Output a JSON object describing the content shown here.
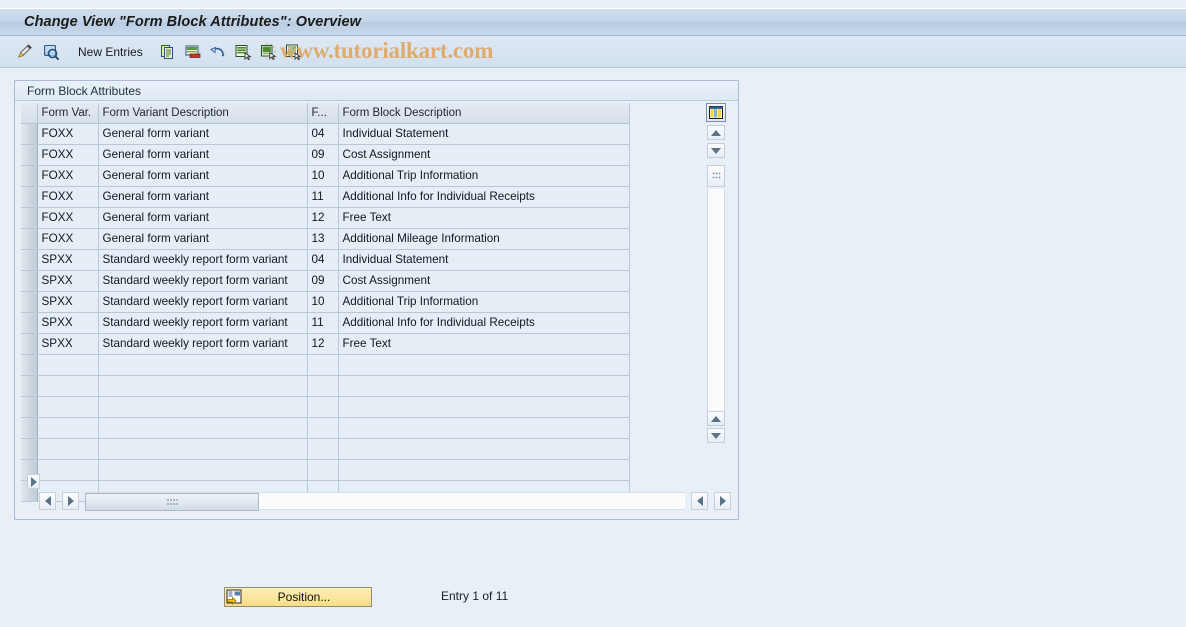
{
  "window": {
    "title": "Change View \"Form Block Attributes\": Overview"
  },
  "watermark": "www.tutorialkart.com",
  "toolbar": {
    "new_entries_label": "New Entries",
    "icons": [
      "display-change-icon",
      "display-detail-icon",
      "copy-icon",
      "delete-icon",
      "undo-icon",
      "select-all-icon",
      "select-block-icon",
      "deselect-icon"
    ]
  },
  "panel": {
    "title": "Form Block Attributes"
  },
  "table": {
    "columns": [
      "Form Var.",
      "Form Variant Description",
      "F...",
      "Form Block Description"
    ],
    "rows": [
      {
        "var": "FOXX",
        "vardesc": "General form variant",
        "f": "04",
        "blockdesc": "Individual Statement"
      },
      {
        "var": "FOXX",
        "vardesc": "General form variant",
        "f": "09",
        "blockdesc": "Cost Assignment"
      },
      {
        "var": "FOXX",
        "vardesc": "General form variant",
        "f": "10",
        "blockdesc": "Additional Trip Information"
      },
      {
        "var": "FOXX",
        "vardesc": "General form variant",
        "f": "11",
        "blockdesc": "Additional Info for Individual Receipts"
      },
      {
        "var": "FOXX",
        "vardesc": "General form variant",
        "f": "12",
        "blockdesc": "Free Text"
      },
      {
        "var": "FOXX",
        "vardesc": "General form variant",
        "f": "13",
        "blockdesc": "Additional Mileage Information"
      },
      {
        "var": "SPXX",
        "vardesc": "Standard weekly report form variant",
        "f": "04",
        "blockdesc": "Individual Statement"
      },
      {
        "var": "SPXX",
        "vardesc": "Standard weekly report form variant",
        "f": "09",
        "blockdesc": "Cost Assignment"
      },
      {
        "var": "SPXX",
        "vardesc": "Standard weekly report form variant",
        "f": "10",
        "blockdesc": "Additional Trip Information"
      },
      {
        "var": "SPXX",
        "vardesc": "Standard weekly report form variant",
        "f": "11",
        "blockdesc": "Additional Info for Individual Receipts"
      },
      {
        "var": "SPXX",
        "vardesc": "Standard weekly report form variant",
        "f": "12",
        "blockdesc": "Free Text"
      },
      {
        "var": "",
        "vardesc": "",
        "f": "",
        "blockdesc": ""
      },
      {
        "var": "",
        "vardesc": "",
        "f": "",
        "blockdesc": ""
      },
      {
        "var": "",
        "vardesc": "",
        "f": "",
        "blockdesc": ""
      },
      {
        "var": "",
        "vardesc": "",
        "f": "",
        "blockdesc": ""
      },
      {
        "var": "",
        "vardesc": "",
        "f": "",
        "blockdesc": ""
      },
      {
        "var": "",
        "vardesc": "",
        "f": "",
        "blockdesc": ""
      },
      {
        "var": "",
        "vardesc": "",
        "f": "",
        "blockdesc": ""
      }
    ]
  },
  "footer": {
    "position_label": "Position...",
    "entry_status": "Entry 1 of 11"
  },
  "colors": {
    "title_bar": "#c3d5e8",
    "watermark": "#e0a968",
    "row_bg": "#e5edf5",
    "button_yellow": "#fbe79e"
  }
}
